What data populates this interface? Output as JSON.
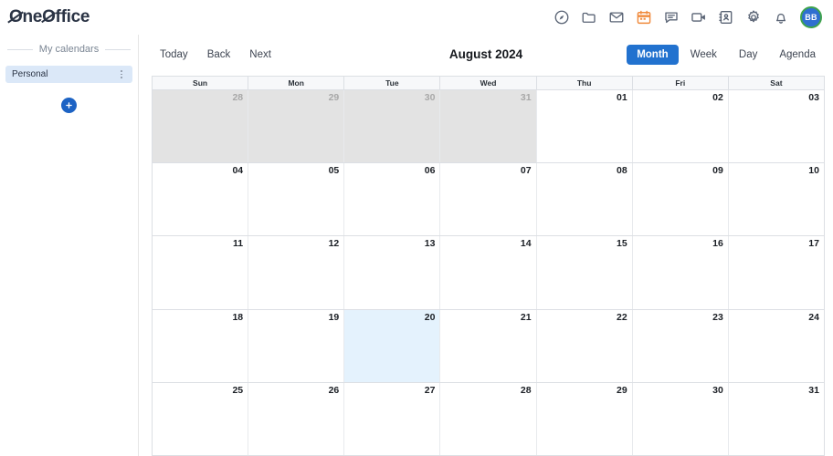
{
  "app": {
    "logo_part1": "n",
    "logo_o1": "O",
    "logo_e": "e",
    "logo_o2": "O",
    "logo_part2": "ffice",
    "logo_full": "OneOffice"
  },
  "header": {
    "icons": [
      {
        "name": "dashboard-icon",
        "label": "Dashboard",
        "accent": false
      },
      {
        "name": "folder-icon",
        "label": "Files",
        "accent": false
      },
      {
        "name": "mail-icon",
        "label": "Mail",
        "accent": false
      },
      {
        "name": "calendar-icon",
        "label": "Calendar",
        "accent": true,
        "color": "#f08a3c"
      },
      {
        "name": "chat-icon",
        "label": "Chat",
        "accent": false
      },
      {
        "name": "video-icon",
        "label": "Video",
        "accent": false
      },
      {
        "name": "contacts-icon",
        "label": "Contacts",
        "accent": false
      },
      {
        "name": "gear-icon",
        "label": "Settings",
        "accent": false
      },
      {
        "name": "bell-icon",
        "label": "Notifications",
        "accent": false
      }
    ],
    "avatar_initials": "BB",
    "avatar_bg": "#2f6fd0",
    "avatar_ring": "#3fa34d"
  },
  "sidebar": {
    "section_title": "My calendars",
    "calendars": [
      {
        "name": "Personal",
        "menu": "more-options"
      }
    ],
    "add_label": "+"
  },
  "toolbar": {
    "today_label": "Today",
    "back_label": "Back",
    "next_label": "Next",
    "title": "August 2024",
    "views": [
      {
        "label": "Month",
        "active": true
      },
      {
        "label": "Week",
        "active": false
      },
      {
        "label": "Day",
        "active": false
      },
      {
        "label": "Agenda",
        "active": false
      }
    ],
    "active_view_color": "#2272cf"
  },
  "calendar": {
    "day_names": [
      "Sun",
      "Mon",
      "Tue",
      "Wed",
      "Thu",
      "Fri",
      "Sat"
    ],
    "today": "20",
    "month": "August",
    "year": "2024",
    "off_month_bg": "#e3e3e3",
    "today_bg": "#e4f2fd",
    "weeks": [
      [
        {
          "num": "28",
          "off": true,
          "today": false
        },
        {
          "num": "29",
          "off": true,
          "today": false
        },
        {
          "num": "30",
          "off": true,
          "today": false
        },
        {
          "num": "31",
          "off": true,
          "today": false
        },
        {
          "num": "01",
          "off": false,
          "today": false
        },
        {
          "num": "02",
          "off": false,
          "today": false
        },
        {
          "num": "03",
          "off": false,
          "today": false
        }
      ],
      [
        {
          "num": "04",
          "off": false,
          "today": false
        },
        {
          "num": "05",
          "off": false,
          "today": false
        },
        {
          "num": "06",
          "off": false,
          "today": false
        },
        {
          "num": "07",
          "off": false,
          "today": false
        },
        {
          "num": "08",
          "off": false,
          "today": false
        },
        {
          "num": "09",
          "off": false,
          "today": false
        },
        {
          "num": "10",
          "off": false,
          "today": false
        }
      ],
      [
        {
          "num": "11",
          "off": false,
          "today": false
        },
        {
          "num": "12",
          "off": false,
          "today": false
        },
        {
          "num": "13",
          "off": false,
          "today": false
        },
        {
          "num": "14",
          "off": false,
          "today": false
        },
        {
          "num": "15",
          "off": false,
          "today": false
        },
        {
          "num": "16",
          "off": false,
          "today": false
        },
        {
          "num": "17",
          "off": false,
          "today": false
        }
      ],
      [
        {
          "num": "18",
          "off": false,
          "today": false
        },
        {
          "num": "19",
          "off": false,
          "today": false
        },
        {
          "num": "20",
          "off": false,
          "today": true
        },
        {
          "num": "21",
          "off": false,
          "today": false
        },
        {
          "num": "22",
          "off": false,
          "today": false
        },
        {
          "num": "23",
          "off": false,
          "today": false
        },
        {
          "num": "24",
          "off": false,
          "today": false
        }
      ],
      [
        {
          "num": "25",
          "off": false,
          "today": false
        },
        {
          "num": "26",
          "off": false,
          "today": false
        },
        {
          "num": "27",
          "off": false,
          "today": false
        },
        {
          "num": "28",
          "off": false,
          "today": false
        },
        {
          "num": "29",
          "off": false,
          "today": false
        },
        {
          "num": "30",
          "off": false,
          "today": false
        },
        {
          "num": "31",
          "off": false,
          "today": false
        }
      ]
    ]
  }
}
